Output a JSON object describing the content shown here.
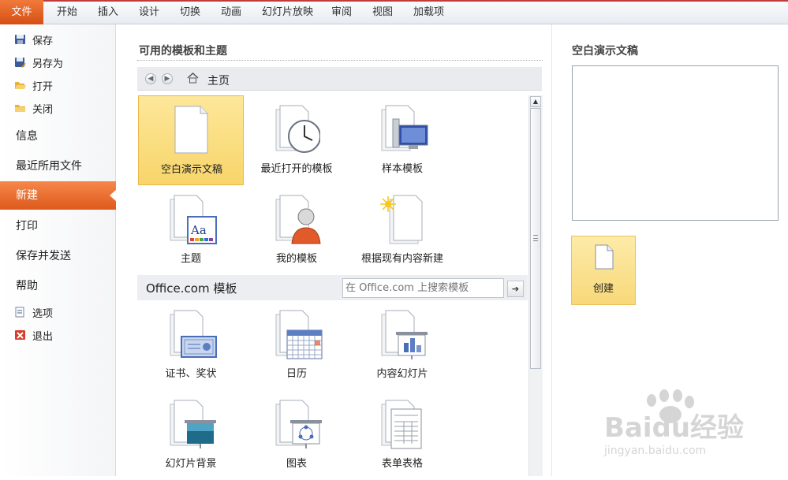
{
  "ribbon": {
    "file_tab": "文件",
    "tabs": [
      "开始",
      "插入",
      "设计",
      "切换",
      "动画",
      "幻灯片放映",
      "审阅",
      "视图",
      "加载项"
    ]
  },
  "backstage": {
    "small_items_top": [
      {
        "label": "保存",
        "icon": "save-icon"
      },
      {
        "label": "另存为",
        "icon": "save-as-icon"
      },
      {
        "label": "打开",
        "icon": "open-folder-icon"
      },
      {
        "label": "关闭",
        "icon": "close-folder-icon"
      }
    ],
    "big_items": [
      "信息",
      "最近所用文件",
      "新建",
      "打印",
      "保存并发送",
      "帮助"
    ],
    "small_items_bottom": [
      {
        "label": "选项",
        "icon": "options-icon"
      },
      {
        "label": "退出",
        "icon": "exit-icon"
      }
    ],
    "selected": "新建"
  },
  "templates": {
    "section_title": "可用的模板和主题",
    "nav": {
      "home_label": "主页"
    },
    "local": [
      "空白演示文稿",
      "最近打开的模板",
      "样本模板",
      "主题",
      "我的模板",
      "根据现有内容新建"
    ],
    "office": {
      "title": "Office.com 模板",
      "search_placeholder": "在 Office.com 上搜索模板",
      "items": [
        "证书、奖状",
        "日历",
        "内容幻灯片",
        "幻灯片背景",
        "图表",
        "表单表格"
      ]
    }
  },
  "preview": {
    "title": "空白演示文稿",
    "create_label": "创建"
  },
  "watermark": {
    "brand": "Baidu经验",
    "url": "jingyan.baidu.com"
  },
  "colors": {
    "accent": "#e8682a",
    "selected_tile": "#f9d97a"
  }
}
